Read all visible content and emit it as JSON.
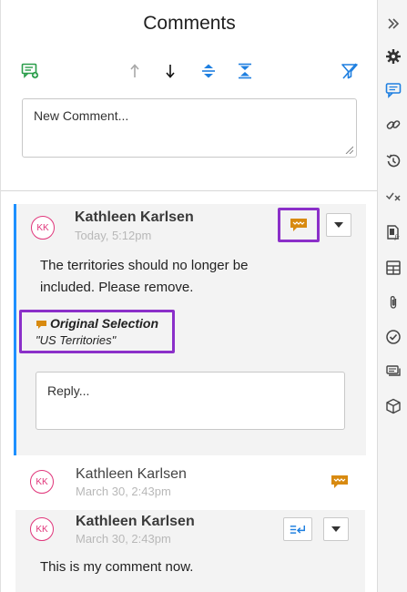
{
  "panel": {
    "title": "Comments",
    "new_comment_placeholder": "New Comment..."
  },
  "toolbar": {
    "add_comment": "add-comment-icon",
    "sort_up": "arrow-up-icon",
    "sort_down": "arrow-down-icon",
    "expand_all": "expand-icon",
    "collapse_all": "collapse-icon",
    "filter": "filter-icon"
  },
  "comments": [
    {
      "initials": "KK",
      "author": "Kathleen Karlsen",
      "time": "Today, 5:12pm",
      "text_line1": "The territories should no longer be",
      "text_line2": "included. Please remove.",
      "original_selection_label": "Original Selection",
      "original_selection_text": "\"US Territories\"",
      "reply_placeholder": "Reply..."
    },
    {
      "initials": "KK",
      "author": "Kathleen Karlsen",
      "time": "March 30, 2:43pm"
    },
    {
      "initials": "KK",
      "author": "Kathleen Karlsen",
      "time": "March 30, 2:43pm",
      "text": "This is my comment now."
    }
  ],
  "rail": [
    "chevron-double-right-icon",
    "gear-icon",
    "comment-icon",
    "link-icon",
    "history-icon",
    "tracked-changes-icon",
    "formula-icon",
    "table-icon",
    "paperclip-icon",
    "check-circle-icon",
    "layers-icon",
    "cube-icon"
  ],
  "colors": {
    "accent_blue": "#1e90ff",
    "highlight_purple": "#8b2fc9",
    "comment_orange": "#d88a10",
    "avatar_pink": "#e0357a"
  }
}
